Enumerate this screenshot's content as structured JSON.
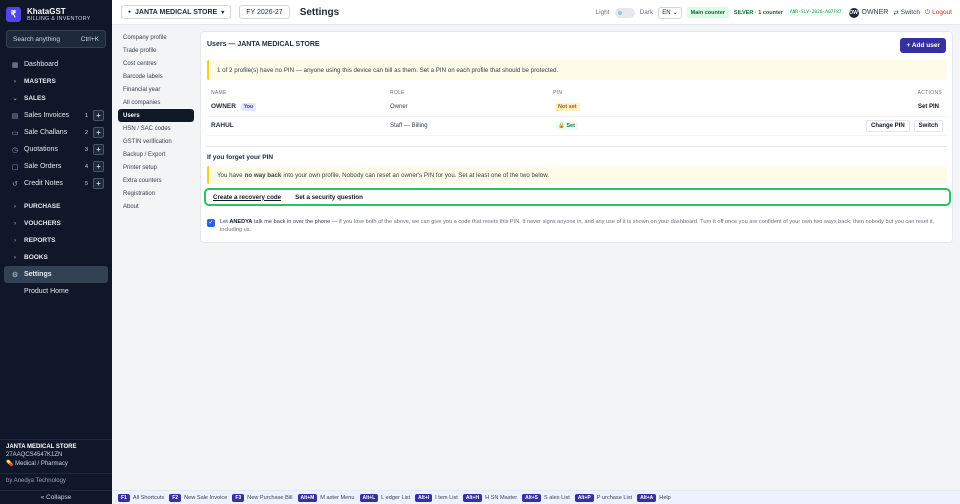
{
  "brand": {
    "name": "KhataGST",
    "sub": "BILLING & INVENTORY",
    "logo": "₹"
  },
  "search": {
    "placeholder": "Search anything",
    "shortcut": "Ctrl+K"
  },
  "sidebar": {
    "dashboard": "Dashboard",
    "masters": "MASTERS",
    "sales": "SALES",
    "sales_items": [
      {
        "label": "Sales Invoices",
        "count": "1"
      },
      {
        "label": "Sale Challans",
        "count": "2"
      },
      {
        "label": "Quotations",
        "count": "3"
      },
      {
        "label": "Sale Orders",
        "count": "4"
      },
      {
        "label": "Credit Notes",
        "count": "5"
      }
    ],
    "purchase": "PURCHASE",
    "vouchers": "VOUCHERS",
    "reports": "REPORTS",
    "books": "BOOKS",
    "settings": "Settings",
    "product_home": "Product Home"
  },
  "store": {
    "name": "JANTA MEDICAL STORE",
    "gstin": "27AAQCS4547K1ZN",
    "type": "Medical / Pharmacy"
  },
  "by": "by Anedya Technology",
  "collapse": "« Collapse",
  "topbar": {
    "store": "JANTA MEDICAL STORE",
    "fy": "FY 2026-27",
    "title": "Settings",
    "light": "Light",
    "dark": "Dark",
    "lang": "EN",
    "counter": "Main counter",
    "plan": "SILVER · 1 counter",
    "license": "ANR-SLV-2026-A07F87",
    "owner_initials": "OW",
    "owner": "OWNER",
    "switch": "Switch",
    "logout": "Logout"
  },
  "settings_nav": [
    "Company profile",
    "Trade profile",
    "Cost centres",
    "Barcode labels",
    "Financial year",
    "All companies",
    "Users",
    "HSN / SAC codes",
    "GSTIN verification",
    "Backup / Export",
    "Printer setup",
    "Extra counters",
    "Registration",
    "About"
  ],
  "users": {
    "title": "Users — JANTA MEDICAL STORE",
    "add_label": "+ Add user",
    "warning": "1 of 2 profile(s) have no PIN — anyone using this device can bill as them. Set a PIN on each profile that should be protected.",
    "cols": {
      "name": "NAME",
      "role": "ROLE",
      "pin": "PIN",
      "actions": "ACTIONS"
    },
    "rows": [
      {
        "name": "OWNER",
        "you": "You",
        "role": "Owner",
        "pin": "Not set",
        "actions": [
          "Set PIN"
        ]
      },
      {
        "name": "RAHUL",
        "role": "Staff — Billing",
        "pin": "🔒 Set",
        "actions": [
          "Change PIN",
          "Switch"
        ]
      }
    ]
  },
  "forgot": {
    "title": "If you forget your PIN",
    "info_pre": "You have ",
    "info_bold": "no way back",
    "info_post": " into your own profile. Nobody can reset an owner's PIN for you. Set at least one of the two below.",
    "opt1": "Create a recovery code",
    "opt2": "Set a security question",
    "consent_pre": "Let ",
    "consent_bold": "ANEDYA",
    "consent_mid": " talk me back in over the phone — ",
    "consent_hint": "if you lose both of the above, we can give you a code that resets this PIN. It never signs anyone in, and any use of it is shown on your dashboard. Turn it off once you are confident of your own two ways back; then nobody but you can reset it, including us."
  },
  "shortcuts": [
    {
      "key": "F1",
      "label": "All Shortcuts"
    },
    {
      "key": "F2",
      "label": "New Sale Invoice"
    },
    {
      "key": "F3",
      "label": "New Purchase Bill"
    },
    {
      "key": "Alt+M",
      "label": "M aster Menu"
    },
    {
      "key": "Alt+L",
      "label": "L edger List"
    },
    {
      "key": "Alt+I",
      "label": "I tem List"
    },
    {
      "key": "Alt+H",
      "label": "H SN Master"
    },
    {
      "key": "Alt+S",
      "label": "S ales List"
    },
    {
      "key": "Alt+P",
      "label": "P urchase List"
    },
    {
      "key": "Alt+A",
      "label": "Help"
    }
  ]
}
